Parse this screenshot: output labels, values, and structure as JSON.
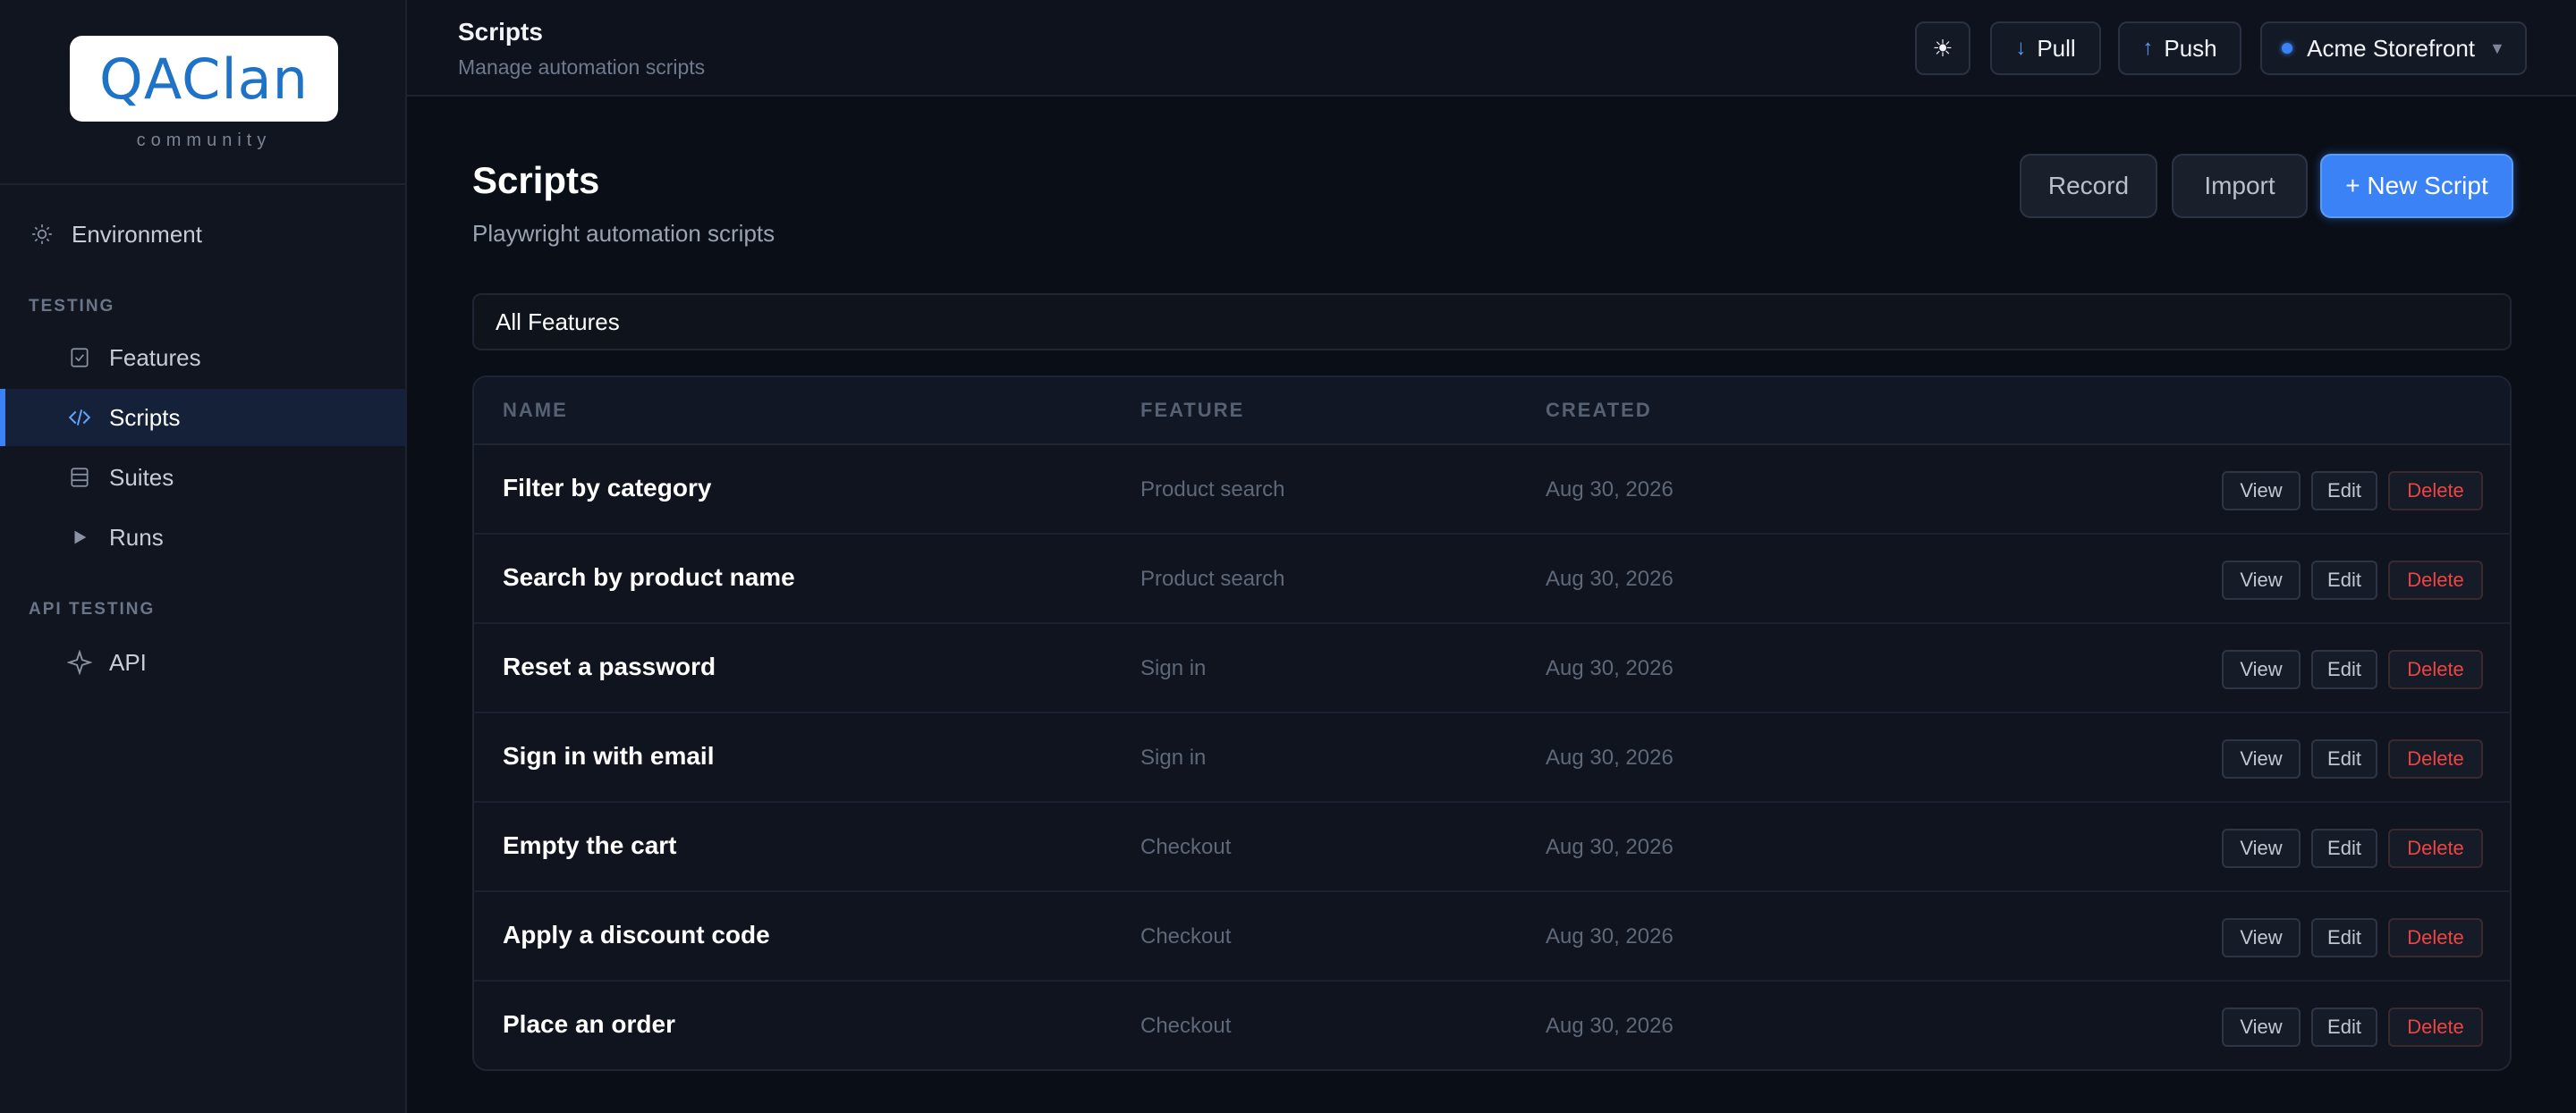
{
  "brand": {
    "logo_text": "QAClan",
    "subtitle": "community"
  },
  "sidebar": {
    "environment_label": "Environment",
    "testing_section": "TESTING",
    "items": [
      {
        "label": "Features",
        "icon": "checklist-icon"
      },
      {
        "label": "Scripts",
        "icon": "code-icon",
        "active": true
      },
      {
        "label": "Suites",
        "icon": "stack-icon"
      },
      {
        "label": "Runs",
        "icon": "play-icon"
      }
    ],
    "api_section": "API TESTING",
    "api_item": {
      "label": "API",
      "icon": "sparkle-icon"
    }
  },
  "topbar": {
    "title": "Scripts",
    "subtitle": "Manage automation scripts",
    "theme_icon": "☀",
    "pull_label": "Pull",
    "push_label": "Push",
    "project_name": "Acme Storefront"
  },
  "main": {
    "title": "Scripts",
    "subtitle": "Playwright automation scripts",
    "record_label": "Record",
    "import_label": "Import",
    "new_script_label": "+ New Script",
    "filter_value": "All Features"
  },
  "table": {
    "headers": {
      "name": "NAME",
      "feature": "FEATURE",
      "created": "CREATED"
    },
    "action_labels": {
      "view": "View",
      "edit": "Edit",
      "delete": "Delete"
    },
    "rows": [
      {
        "name": "Filter by category",
        "feature": "Product search",
        "created": "Aug 30, 2026"
      },
      {
        "name": "Search by product name",
        "feature": "Product search",
        "created": "Aug 30, 2026"
      },
      {
        "name": "Reset a password",
        "feature": "Sign in",
        "created": "Aug 30, 2026"
      },
      {
        "name": "Sign in with email",
        "feature": "Sign in",
        "created": "Aug 30, 2026"
      },
      {
        "name": "Empty the cart",
        "feature": "Checkout",
        "created": "Aug 30, 2026"
      },
      {
        "name": "Apply a discount code",
        "feature": "Checkout",
        "created": "Aug 30, 2026"
      },
      {
        "name": "Place an order",
        "feature": "Checkout",
        "created": "Aug 30, 2026"
      }
    ]
  },
  "colors": {
    "accent": "#3b82f6",
    "danger": "#ef4444",
    "background": "#0a0e17"
  }
}
